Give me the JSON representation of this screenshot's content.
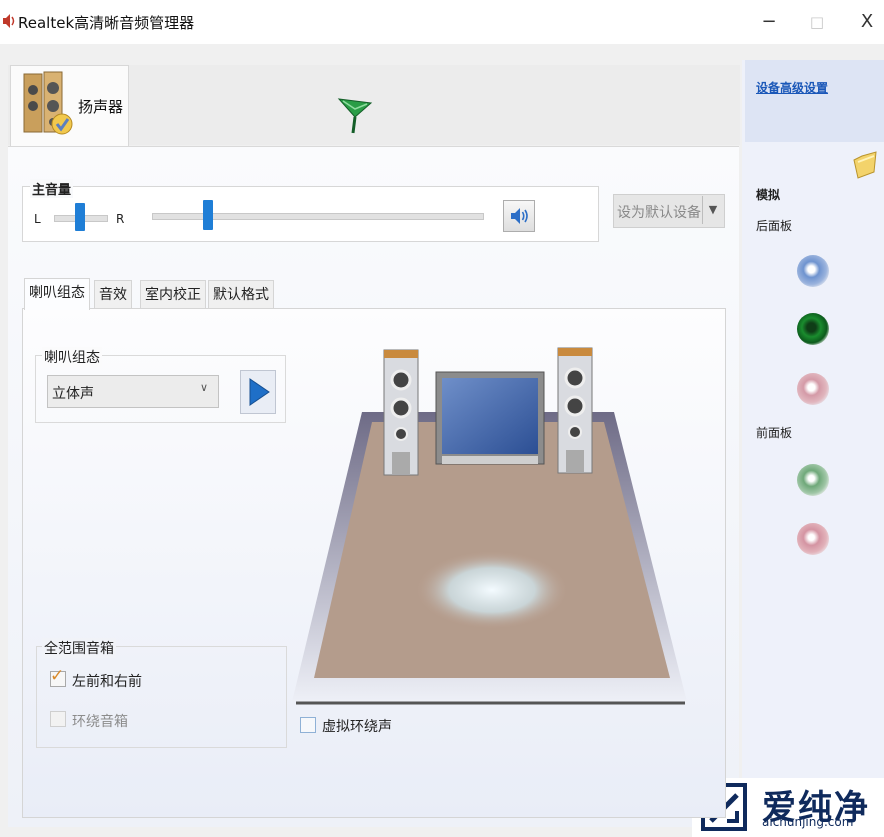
{
  "window": {
    "title": "Realtek高清晰音频管理器",
    "controls": {
      "minimize": "−",
      "maximize": "□",
      "close": "X"
    },
    "icons": {
      "app": "speaker-icon",
      "minimize": "minimize-icon",
      "maximize": "maximize-icon",
      "close": "close-icon"
    }
  },
  "device_tabs": [
    {
      "label": "扬声器",
      "icon": "speakers-icon",
      "selected": true
    },
    {
      "label": "",
      "icon": "green-connector-icon",
      "selected": false
    }
  ],
  "master_volume": {
    "label": "主音量",
    "balance_left": "L",
    "balance_right": "R",
    "balance_level": 0.5,
    "volume_level": 0.17,
    "mute_icon": "speaker-volume-icon",
    "default_device_button": "设为默认设备"
  },
  "inner_tabs": [
    {
      "label": "喇叭组态",
      "selected": true
    },
    {
      "label": "音效",
      "selected": false
    },
    {
      "label": "室内校正",
      "selected": false
    },
    {
      "label": "默认格式",
      "selected": false
    }
  ],
  "speaker_config": {
    "group_label": "喇叭组态",
    "selected": "立体声",
    "play_icon": "play-icon"
  },
  "full_range": {
    "group_label": "全范围音箱",
    "options": [
      {
        "label": "左前和右前",
        "checked": true,
        "enabled": true
      },
      {
        "label": "环绕音箱",
        "checked": false,
        "enabled": false
      }
    ]
  },
  "virtual_surround": {
    "label": "虚拟环绕声",
    "checked": false
  },
  "right_panel": {
    "advanced_link": "设备高级设置",
    "analog_label": "模拟",
    "back_panel_label": "后面板",
    "front_panel_label": "前面板",
    "folder_icon": "folder-icon",
    "jack_colors": {
      "back": [
        "#7f9fd6",
        "#1a8c2e",
        "#d9a3b0"
      ],
      "front": [
        "#7fb58a",
        "#d99aa8"
      ]
    }
  },
  "watermark": {
    "text": "爱纯净",
    "url": "aichunjing.com"
  }
}
